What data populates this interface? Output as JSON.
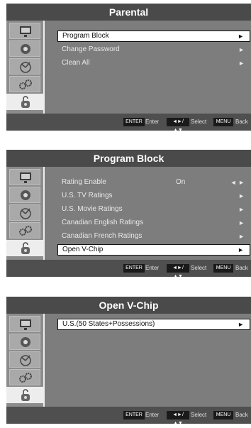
{
  "panels": [
    {
      "title": "Parental",
      "items": [
        {
          "label": "Program Block",
          "value": "",
          "arrow": "►"
        },
        {
          "label": "Change Password",
          "value": "",
          "arrow": "►"
        },
        {
          "label": "Clean All",
          "value": "",
          "arrow": "►"
        }
      ]
    },
    {
      "title": "Program Block",
      "items": [
        {
          "label": "Rating Enable",
          "value": "On",
          "arrow": "◄ ►"
        },
        {
          "label": "U.S. TV Ratings",
          "value": "",
          "arrow": "►"
        },
        {
          "label": "U.S. Movie Ratings",
          "value": "",
          "arrow": "►"
        },
        {
          "label": "Canadian English Ratings",
          "value": "",
          "arrow": "►"
        },
        {
          "label": "Canadian French Ratings",
          "value": "",
          "arrow": "►"
        },
        {
          "label": "Open V-Chip",
          "value": "",
          "arrow": "►"
        }
      ]
    },
    {
      "title": "Open V-Chip",
      "items": [
        {
          "label": "U.S.(50 States+Possessions)",
          "value": "",
          "arrow": "►"
        }
      ]
    }
  ],
  "footer": {
    "enter_key": "ENTER",
    "enter_label": "Enter",
    "select_key": "◄►/▲▼",
    "select_label": "Select",
    "menu_key": "MENU",
    "menu_label": "Back"
  },
  "sidebar_icons": [
    "picture-icon",
    "sound-icon",
    "channel-icon",
    "setup-icon",
    "parental-lock-icon"
  ],
  "colors": {
    "panel": "#7d7d7d",
    "title_bar": "#4a4a4a",
    "highlight": "#ffffff",
    "active_tile": "#ededed"
  }
}
